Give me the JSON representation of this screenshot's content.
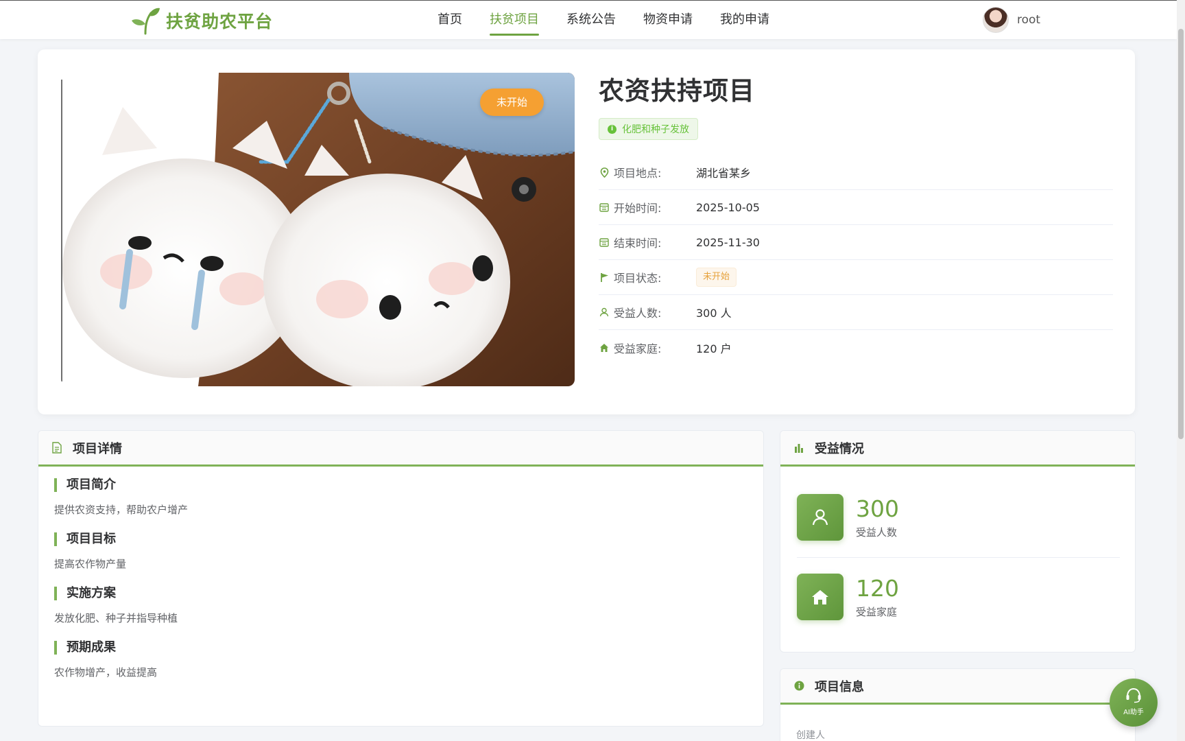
{
  "header": {
    "logo_text": "扶贫助农平台",
    "nav": [
      "首页",
      "扶贫项目",
      "系统公告",
      "物资申请",
      "我的申请"
    ],
    "active_nav": 1,
    "username": "root"
  },
  "project": {
    "image_badge": "未开始",
    "title": "农资扶持项目",
    "tag": "化肥和种子发放",
    "rows": [
      {
        "icon": "location-icon",
        "label": "项目地点:",
        "value": "湖北省某乡"
      },
      {
        "icon": "calendar-icon",
        "label": "开始时间:",
        "value": "2025-10-05"
      },
      {
        "icon": "calendar-icon",
        "label": "结束时间:",
        "value": "2025-11-30"
      },
      {
        "icon": "flag-icon",
        "label": "项目状态:",
        "value": "未开始"
      },
      {
        "icon": "user-icon",
        "label": "受益人数:",
        "value": "300 人"
      },
      {
        "icon": "house-icon",
        "label": "受益家庭:",
        "value": "120 户"
      }
    ]
  },
  "detail": {
    "title": "项目详情",
    "sections": [
      {
        "title": "项目简介",
        "text": "提供农资支持，帮助农户增产"
      },
      {
        "title": "项目目标",
        "text": "提高农作物产量"
      },
      {
        "title": "实施方案",
        "text": "发放化肥、种子并指导种植"
      },
      {
        "title": "预期成果",
        "text": "农作物增产，收益提高"
      }
    ]
  },
  "benefit": {
    "title": "受益情况",
    "people_num": "300",
    "people_label": "受益人数",
    "family_num": "120",
    "family_label": "受益家庭"
  },
  "info": {
    "title": "项目信息",
    "creator_label": "创建人"
  },
  "ai": {
    "label": "AI助手"
  },
  "colors": {
    "accent": "#6ea341",
    "warning": "#f5a032",
    "success": "#67c23a"
  }
}
